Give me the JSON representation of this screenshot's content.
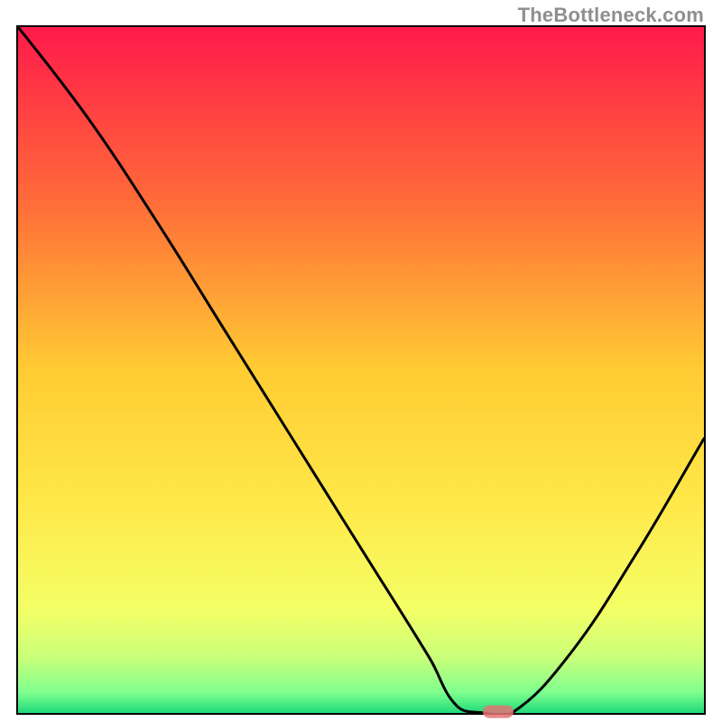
{
  "watermark": "TheBottleneck.com",
  "chart_data": {
    "type": "line",
    "title": "",
    "xlabel": "",
    "ylabel": "",
    "xlim": [
      0,
      100
    ],
    "ylim": [
      0,
      100
    ],
    "grid": false,
    "legend": false,
    "series": [
      {
        "name": "curve",
        "x": [
          0,
          10,
          20,
          30,
          40,
          50,
          60,
          64,
          68,
          72,
          80,
          90,
          100
        ],
        "y": [
          100,
          87,
          72,
          56,
          40,
          24,
          8,
          1,
          0,
          0,
          8,
          23,
          40
        ]
      }
    ],
    "marker": {
      "x_pct": 70,
      "y_pct": 0
    },
    "background_gradient": {
      "stops": [
        {
          "offset": 0.0,
          "color": "#ff1a4b"
        },
        {
          "offset": 0.25,
          "color": "#ff6a39"
        },
        {
          "offset": 0.5,
          "color": "#ffcc33"
        },
        {
          "offset": 0.7,
          "color": "#ffe94a"
        },
        {
          "offset": 0.85,
          "color": "#f3ff66"
        },
        {
          "offset": 0.92,
          "color": "#c9ff7a"
        },
        {
          "offset": 0.97,
          "color": "#7fff8e"
        },
        {
          "offset": 1.0,
          "color": "#1fd97a"
        }
      ]
    }
  }
}
